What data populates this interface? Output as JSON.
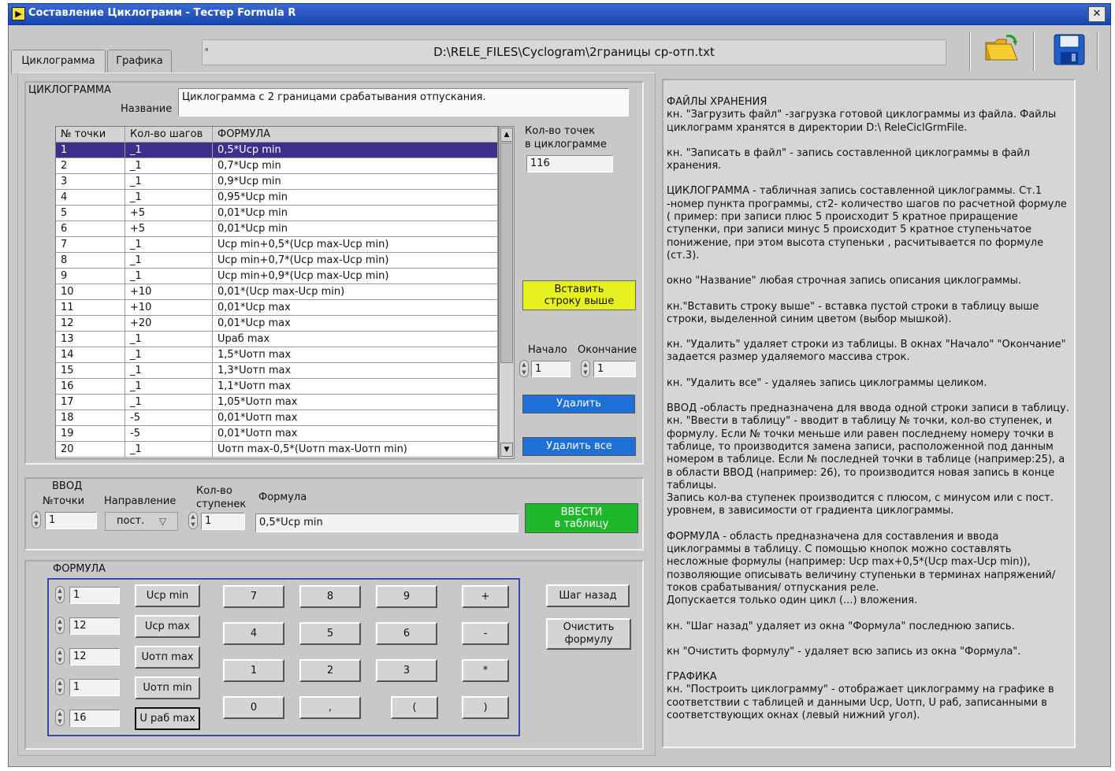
{
  "window": {
    "title": "Составление Циклограмм - Тестер Formula R",
    "close_label": "✕",
    "app_icon": "▶"
  },
  "tabs": [
    "Циклограмма",
    "Графика"
  ],
  "path": {
    "indicator": "ᵃ",
    "value": "D:\\RELE_FILES\\Cyclogram\\2границы ср-отп.txt"
  },
  "toolbar": {
    "open_icon": "folder-open-icon",
    "save_icon": "floppy-disk-icon"
  },
  "cyclogram": {
    "panel_label": "ЦИКЛОГРАММА",
    "name_label": "Название",
    "name_value": "Циклограмма с 2 границами срабатывания отпускания.",
    "columns": [
      "№ точки",
      "Кол-во шагов",
      "ФОРМУЛА"
    ],
    "rows": [
      [
        "1",
        "_1",
        "0,5*Uср min"
      ],
      [
        "2",
        "_1",
        "0,7*Uср min"
      ],
      [
        "3",
        "_1",
        "0,9*Uср min"
      ],
      [
        "4",
        "_1",
        "0,95*Uср min"
      ],
      [
        "5",
        "+5",
        "0,01*Uср min"
      ],
      [
        "6",
        "+5",
        "0,01*Uср min"
      ],
      [
        "7",
        "_1",
        "Uср min+0,5*(Uср max-Uср min)"
      ],
      [
        "8",
        "_1",
        "Uср min+0,7*(Uср max-Uср min)"
      ],
      [
        "9",
        "_1",
        "Uср min+0,9*(Uср max-Uср min)"
      ],
      [
        "10",
        "+10",
        "0,01*(Uср max-Uср min)"
      ],
      [
        "11",
        "+10",
        "0,01*Uср max"
      ],
      [
        "12",
        "+20",
        "0,01*Uср max"
      ],
      [
        "13",
        "_1",
        "Uраб max"
      ],
      [
        "14",
        "_1",
        "1,5*Uотп max"
      ],
      [
        "15",
        "_1",
        "1,3*Uотп max"
      ],
      [
        "16",
        "_1",
        "1,1*Uотп max"
      ],
      [
        "17",
        "_1",
        "1,05*Uотп max"
      ],
      [
        "18",
        "-5",
        "0,01*Uотп max"
      ],
      [
        "19",
        "-5",
        "0,01*Uотп max"
      ],
      [
        "20",
        "_1",
        "Uотп max-0,5*(Uотп max-Uотп min)"
      ]
    ],
    "selected_row": 1,
    "count_label_1": "Кол-во точек",
    "count_label_2": "в циклограмме",
    "count_value": "116",
    "insert_btn_1": "Вставить",
    "insert_btn_2": "строку выше",
    "start_label": "Начало",
    "end_label": "Окончание",
    "start_value": "1",
    "end_value": "1",
    "delete_btn": "Удалить",
    "delete_all_btn": "Удалить все"
  },
  "input": {
    "panel_label": "ВВОД",
    "point_label": "№точки",
    "point_value": "1",
    "direction_label": "Направление",
    "direction_value": "пост.",
    "steps_label_1": "Кол-во",
    "steps_label_2": "ступенек",
    "steps_value": "1",
    "formula_label": "Формула",
    "formula_value": "0,5*Uср min",
    "enter_btn_1": "ВВЕСТИ",
    "enter_btn_2": "в таблицу"
  },
  "formula": {
    "panel_label": "ФОРМУЛА",
    "values": [
      "1",
      "12",
      "12",
      "1",
      "16"
    ],
    "vars": [
      "Uср min",
      "Uср max",
      "Uотп max",
      "Uотп min",
      "U раб max"
    ],
    "keys": [
      "7",
      "8",
      "9",
      "+",
      "4",
      "5",
      "6",
      "-",
      "1",
      "2",
      "3",
      "*",
      "0",
      ",",
      "(",
      ")"
    ],
    "back_btn": "Шаг назад",
    "clear_btn_1": "Очистить",
    "clear_btn_2": "формулу"
  },
  "help": [
    "ФАЙЛЫ ХРАНЕНИЯ\nкн. \"Загрузить файл\" -загрузка готовой циклограммы из файла. Файлы циклограмм хранятся в директории D:\\ ReleCiclGrmFile.",
    "кн. \"Записать в файл\" - запись составленной циклограммы в файл хранения.",
    "ЦИКЛОГРАММА - табличная запись составленной циклограммы.  Ст.1 -номер пункта программы, ст2- количество шагов по расчетной формуле ( пример: при записи плюс 5 происходит 5 кратное приращение ступенки, при записи минус 5 происходит 5 кратное ступеньчатое понижение,  при этом  высота ступеньки , расчитывается по формуле (ст.3).",
    "окно \"Название\" любая строчная запись описания циклограммы.",
    "кн.\"Вставить строку выше\" - вставка пустой строки в таблицу выше строки, выделенной синим цветом (выбор мышкой).",
    "кн. \"Удалить\" удаляет строки из таблицы. В окнах \"Начало\" \"Окончание\" задается размер удаляемого массива строк.",
    "кн. \"Удалить все\" - удаляеь запись циклограммы целиком.",
    "ВВОД -область предназначена для ввода одной строки записи в таблицу. кн. \"Ввести в таблицу\" - вводит в таблицу № точки, кол-во ступенек, и формулу. Если № точки меньше или равен последнему номеру точки в таблице, то производится замена записи, расположенной под данным номером в таблице. Если № последней точки в таблице (например:25), а в области  ВВОД  (например: 26), то производится новая запись в конце таблицы.\nЗапись кол-ва ступенек производится  с плюсом,  с минусом или с пост. уровнем, в зависимости от градиента  циклограммы.",
    "ФОРМУЛА - область  предназначена для составления и ввода циклограммы в таблицу. С помощью кнопок можно составлять несложные формулы (например: Uср max+0,5*(Uср max-Uср min)), позволяющие описывать величину ступеньки в терминах напряжений/токов срабатывания/ отпускания реле.\n Допускается только один цикл (...) вложения.",
    "кн. \"Шаг назад\" удаляет из окна \"Формула\" последнюю запись.",
    "кн \"Очистить формулу\" - удаляет всю запись из окна \"Формула\".",
    "ГРАФИКА\nкн.  \"Построить циклограмму\" - отображает циклограмму на графике в соответствии с таблицей и данными Uср, Uотп, U раб, записанными в соответствующих окнах (левый нижний угол)."
  ]
}
